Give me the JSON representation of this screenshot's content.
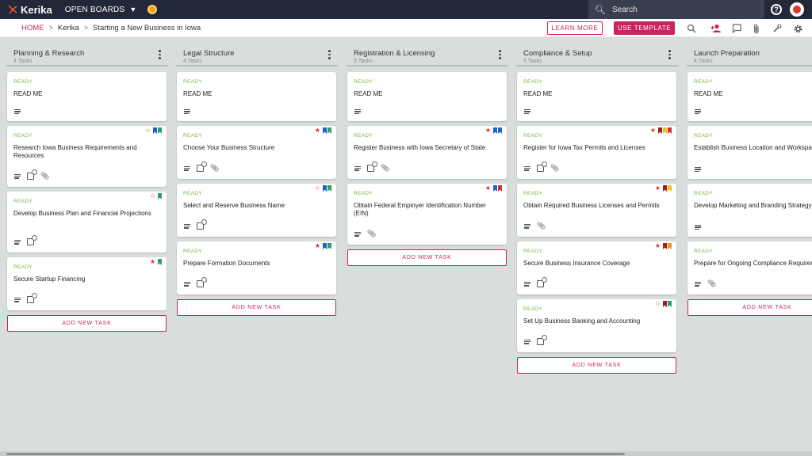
{
  "topbar": {
    "brand": "Kerika",
    "open_boards": "OPEN BOARDS",
    "search_placeholder": "Search",
    "help": "?"
  },
  "subbar": {
    "breadcrumb": [
      "HOME",
      "Kerika",
      "Starting a New Business in Iowa"
    ],
    "learn_more": "LEARN MORE",
    "use_template": "USE TEMPLATE"
  },
  "colors": {
    "accent": "#cc2260",
    "ready": "#7cb342",
    "star_red": "#e02b2b",
    "flag_blue": "#1e63c7",
    "flag_green": "#2e9e6b",
    "flag_red": "#d32f2f",
    "flag_yellow": "#f4c21a",
    "flag_darkred": "#9a2020",
    "flag_orange": "#f28c28"
  },
  "columns": [
    {
      "title": "Planning & Research",
      "count": "4 Tasks",
      "add_label": "ADD NEW TASK",
      "cards": [
        {
          "status": "READY",
          "title": "READ ME",
          "icons": [
            "desc"
          ],
          "star": null,
          "flags": []
        },
        {
          "status": "READY",
          "title": "Research Iowa Business Requirements and Resources",
          "icons": [
            "desc",
            "check",
            "clip"
          ],
          "star": "outline",
          "flags": [
            "blue",
            "green"
          ]
        },
        {
          "status": "READY",
          "title": "Develop Business Plan and Financial Projections",
          "icons": [
            "desc",
            "check"
          ],
          "star": "outline",
          "flags": [
            "green"
          ]
        },
        {
          "status": "READY",
          "title": "Secure Startup Financing",
          "icons": [
            "desc",
            "check"
          ],
          "star": "filled",
          "flags": [
            "green"
          ]
        }
      ]
    },
    {
      "title": "Legal Structure",
      "count": "4 Tasks",
      "add_label": "ADD NEW TASK",
      "cards": [
        {
          "status": "READY",
          "title": "READ ME",
          "icons": [
            "desc"
          ],
          "star": null,
          "flags": []
        },
        {
          "status": "READY",
          "title": "Choose Your Business Structure",
          "icons": [
            "desc",
            "check",
            "clip"
          ],
          "star": "filled",
          "flags": [
            "blue",
            "green"
          ]
        },
        {
          "status": "READY",
          "title": "Select and Reserve Business Name",
          "icons": [
            "desc",
            "check"
          ],
          "star": "outline",
          "flags": [
            "blue",
            "green"
          ]
        },
        {
          "status": "READY",
          "title": "Prepare Formation Documents",
          "icons": [
            "desc",
            "check"
          ],
          "star": "filled",
          "flags": [
            "blue",
            "green"
          ]
        }
      ]
    },
    {
      "title": "Registration & Licensing",
      "count": "3 Tasks",
      "add_label": "ADD NEW TASK",
      "cards": [
        {
          "status": "READY",
          "title": "READ ME",
          "icons": [
            "desc"
          ],
          "star": null,
          "flags": []
        },
        {
          "status": "READY",
          "title": "Register Business with Iowa Secretary of State",
          "icons": [
            "desc",
            "check",
            "clip"
          ],
          "star": "filled",
          "flags": [
            "blue",
            "blue"
          ]
        },
        {
          "status": "READY",
          "title": "Obtain Federal Employer Identification Number (EIN)",
          "icons": [
            "desc",
            "clip"
          ],
          "star": "filled",
          "flags": [
            "blue",
            "red"
          ]
        }
      ]
    },
    {
      "title": "Compliance & Setup",
      "count": "5 Tasks",
      "add_label": "ADD NEW TASK",
      "cards": [
        {
          "status": "READY",
          "title": "READ ME",
          "icons": [
            "desc"
          ],
          "star": null,
          "flags": []
        },
        {
          "status": "READY",
          "title": "Register for Iowa Tax Permits and Licenses",
          "icons": [
            "desc",
            "check",
            "clip"
          ],
          "star": "filled",
          "flags": [
            "darkred",
            "yellow",
            "red"
          ]
        },
        {
          "status": "READY",
          "title": "Obtain Required Business Licenses and Permits",
          "icons": [
            "desc",
            "clip"
          ],
          "star": "filled",
          "flags": [
            "darkred",
            "yellow"
          ]
        },
        {
          "status": "READY",
          "title": "Secure Business Insurance Coverage",
          "icons": [
            "desc",
            "check"
          ],
          "star": "filled",
          "flags": [
            "darkred",
            "orange"
          ]
        },
        {
          "status": "READY",
          "title": "Set Up Business Banking and Accounting",
          "icons": [
            "desc",
            "check"
          ],
          "star": "outline",
          "flags": [
            "darkred",
            "green"
          ]
        }
      ]
    },
    {
      "title": "Launch Preparation",
      "count": "4 Tasks",
      "add_label": "ADD NEW TASK",
      "cards": [
        {
          "status": "READY",
          "title": "READ ME",
          "icons": [
            "desc"
          ],
          "star": null,
          "flags": []
        },
        {
          "status": "READY",
          "title": "Establish Business Location and Workspace",
          "icons": [
            "desc"
          ],
          "star": null,
          "flags": []
        },
        {
          "status": "READY",
          "title": "Develop Marketing and Branding Strategy",
          "icons": [
            "desc"
          ],
          "star": null,
          "flags": []
        },
        {
          "status": "READY",
          "title": "Prepare for Ongoing Compliance Requirements",
          "icons": [
            "desc",
            "clip"
          ],
          "star": null,
          "flags": []
        }
      ]
    }
  ]
}
